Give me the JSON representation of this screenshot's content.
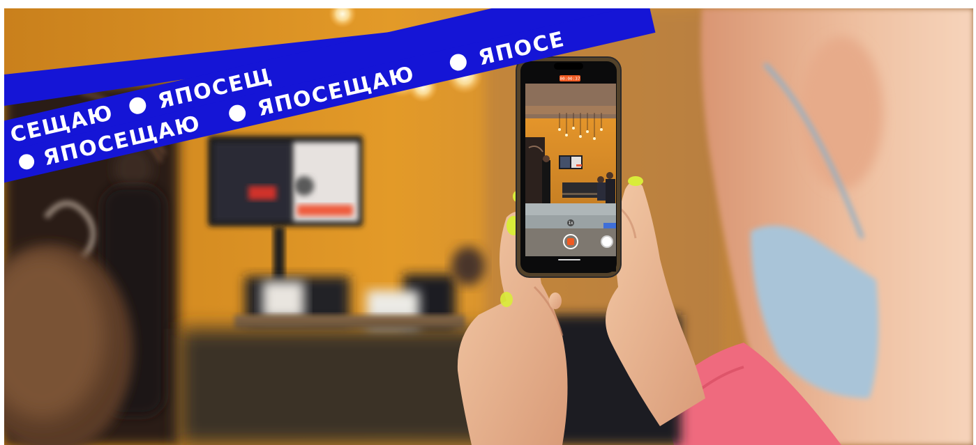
{
  "banner": {
    "word": "ЯПОСЕЩАЮ",
    "fragment_start": "СЕЩАЮ",
    "fragment_top": "ЯПОСЕЩ",
    "fragment_end": "ЯПОСЕ",
    "color": "#1515d6"
  },
  "phone": {
    "recording_time": "00:00:37",
    "record_color": "#f05a22",
    "lens_label": "1x"
  },
  "colors": {
    "wall": "#e0931f",
    "sleeve": "#f06a7e",
    "nails": "#d9ec3a",
    "mask": "#a9c4d8"
  }
}
